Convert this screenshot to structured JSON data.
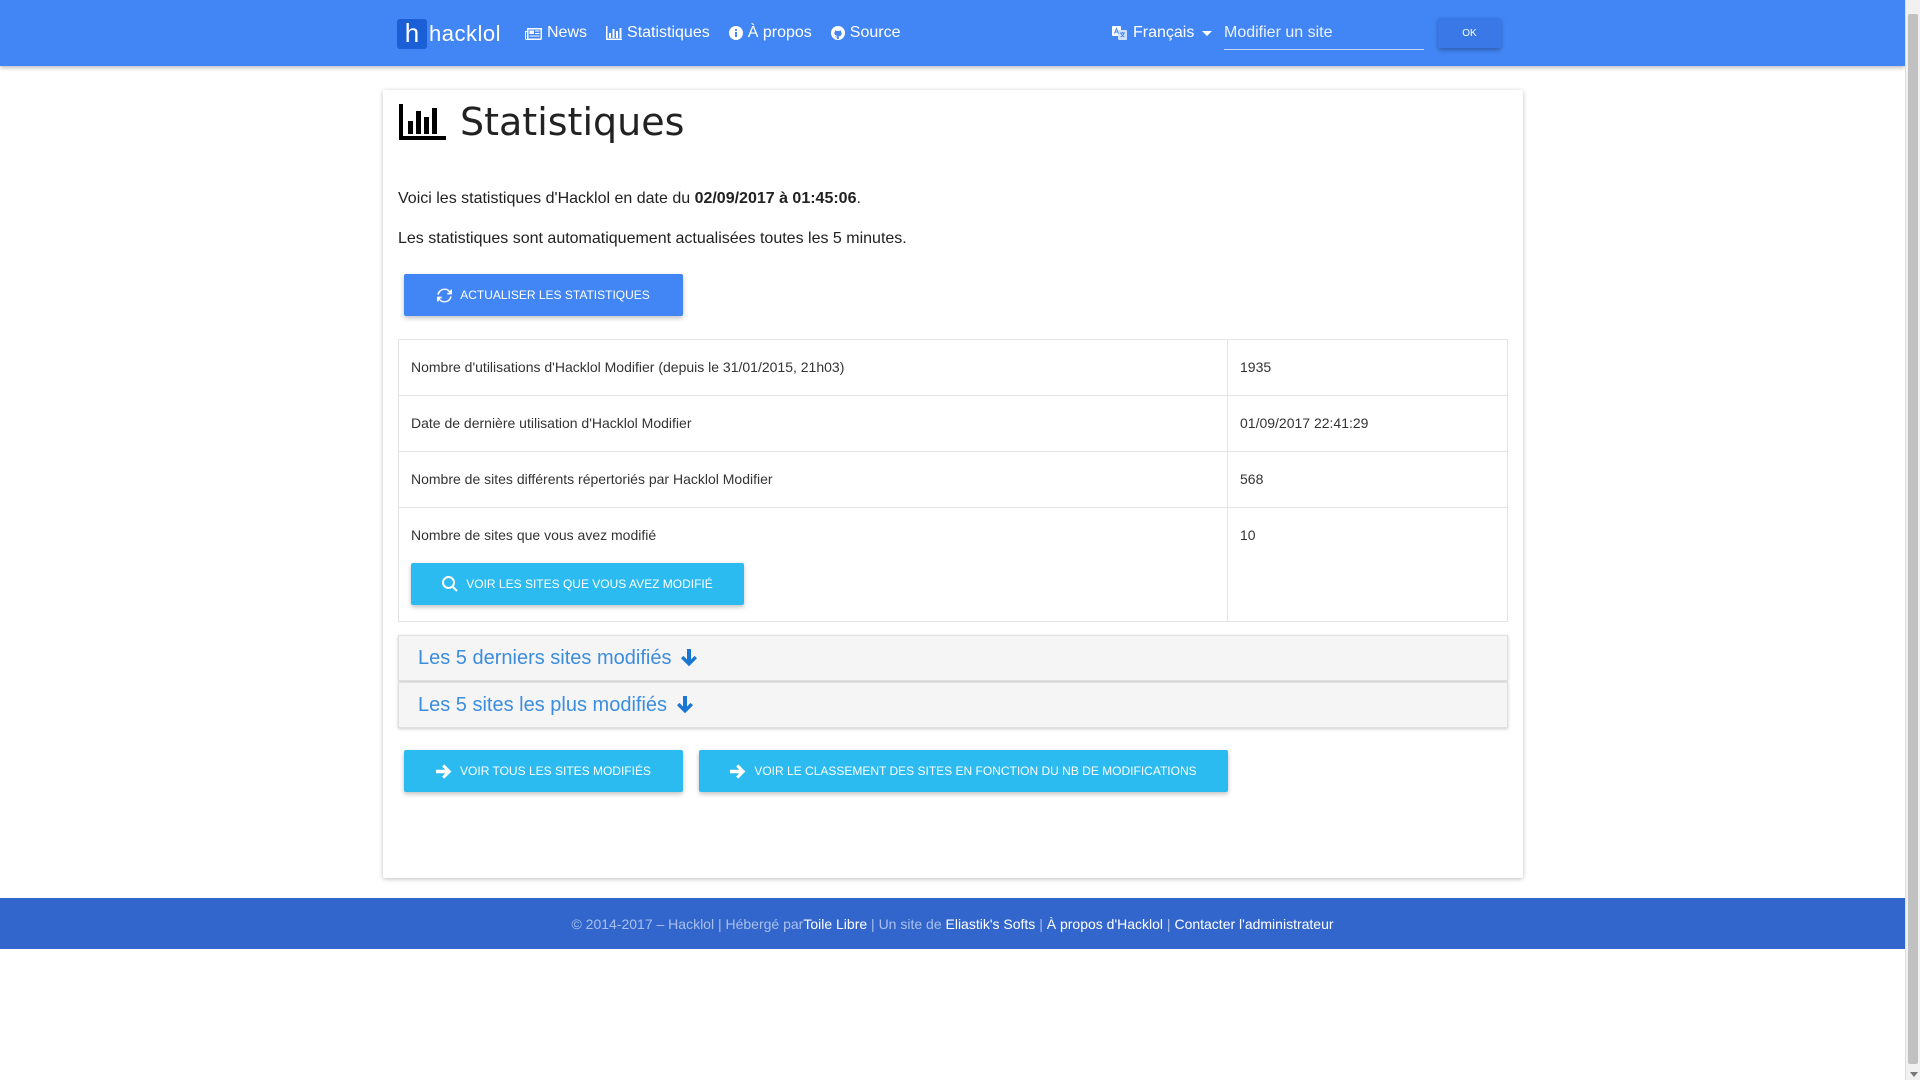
{
  "navbar": {
    "brand_letter": "h",
    "brand_text": "hacklol",
    "links": [
      {
        "label": "News",
        "icon": "newspaper-icon"
      },
      {
        "label": "Statistiques",
        "icon": "bar-chart-icon"
      },
      {
        "label": "À propos",
        "icon": "info-circle-icon"
      },
      {
        "label": "Source",
        "icon": "github-icon"
      }
    ],
    "language": "Français",
    "site_input_placeholder": "Modifier un site",
    "ok_label": "OK"
  },
  "main": {
    "title": "Statistiques",
    "intro_prefix": "Voici les statistiques d'Hacklol en date du ",
    "intro_date": "02/09/2017 à 01:45:06",
    "intro_suffix": ".",
    "auto_update": "Les statistiques sont automatiquement actualisées toutes les 5 minutes.",
    "refresh_label": "Actualiser les statistiques",
    "stats": [
      {
        "label": "Nombre d'utilisations d'Hacklol Modifier (depuis le 31/01/2015, 21h03)",
        "value": "1935"
      },
      {
        "label": "Date de dernière utilisation d'Hacklol Modifier",
        "value": "01/09/2017 22:41:29"
      },
      {
        "label": "Nombre de sites différents répertoriés par Hacklol Modifier",
        "value": "568"
      },
      {
        "label": "Nombre de sites que vous avez modifié",
        "value": "10"
      }
    ],
    "view_my_sites_label": "Voir les sites que vous avez modifié",
    "panels": [
      {
        "title": "Les 5 derniers sites modifiés"
      },
      {
        "title": "Les 5 sites les plus modifiés"
      }
    ],
    "view_all_label": "Voir tous les sites modifiés",
    "view_ranking_label": "Voir le classement des sites en fonction du nb de modifications"
  },
  "footer": {
    "copyright": "© 2014-2017 – Hacklol | Hébergé par ",
    "host_link": "Toile Libre",
    "sep1": " | Un site de ",
    "author_link": "Eliastik's Softs",
    "sep2": " | ",
    "about_link": "À propos d'Hacklol",
    "sep3": " | ",
    "contact_link": "Contacter l'administrateur"
  },
  "colors": {
    "primary": "#4285f4",
    "cyan": "#2bbbf0",
    "footer": "#3266cc",
    "panel_title": "#3b8dde"
  }
}
